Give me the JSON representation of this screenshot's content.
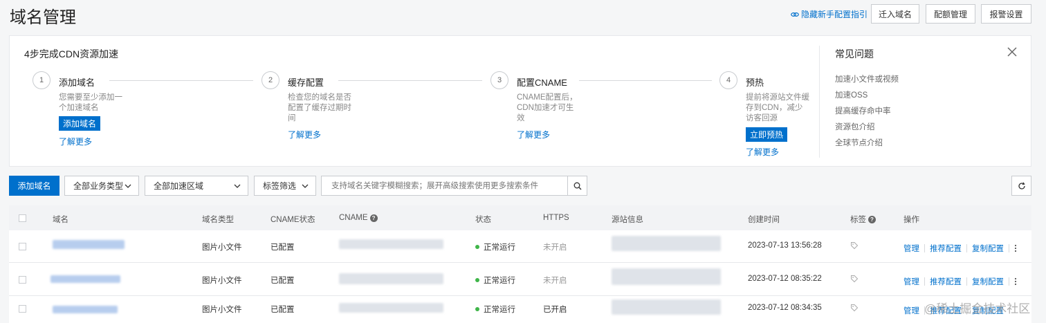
{
  "page": {
    "title": "域名管理"
  },
  "header": {
    "guide_link": "隐藏新手配置指引",
    "buttons": [
      "迁入域名",
      "配额管理",
      "报警设置"
    ]
  },
  "guide": {
    "title": "4步完成CDN资源加速",
    "steps": [
      {
        "num": "1",
        "title": "添加域名",
        "desc": [
          "您需要至少添加一",
          "个加速域名"
        ],
        "button": "添加域名",
        "link": "了解更多"
      },
      {
        "num": "2",
        "title": "缓存配置",
        "desc": [
          "检查您的域名是否",
          "配置了缓存过期时",
          "间"
        ],
        "link": "了解更多"
      },
      {
        "num": "3",
        "title": "配置CNAME",
        "desc": [
          "CNAME配置后，",
          "CDN加速才可生",
          "效"
        ],
        "link": "了解更多"
      },
      {
        "num": "4",
        "title": "预热",
        "desc": [
          "提前将源站文件缓",
          "存到CDN，减少",
          "访客回源"
        ],
        "button": "立即预热",
        "link": "了解更多"
      }
    ],
    "faq_title": "常见问题",
    "faq": [
      "加速小文件或视频",
      "加速OSS",
      "提高缓存命中率",
      "资源包介绍",
      "全球节点介绍"
    ]
  },
  "toolbar": {
    "add_button": "添加域名",
    "business_type": "全部业务类型",
    "region": "全部加速区域",
    "tag_filter": "标签筛选",
    "search_placeholder": "支持域名关键字模糊搜索；展开高级搜索使用更多搜索条件"
  },
  "table": {
    "headers": {
      "domain": "域名",
      "type": "域名类型",
      "cname_status": "CNAME状态",
      "cname": "CNAME",
      "status": "状态",
      "https": "HTTPS",
      "origin": "源站信息",
      "created": "创建时间",
      "tags": "标签",
      "actions": "操作"
    },
    "rows": [
      {
        "type": "图片小文件",
        "cname_status": "已配置",
        "status": "正常运行",
        "https": "未开启",
        "created": "2023-07-13 13:56:28"
      },
      {
        "type": "图片小文件",
        "cname_status": "已配置",
        "status": "正常运行",
        "https": "未开启",
        "created": "2023-07-12 08:35:22"
      },
      {
        "type": "图片小文件",
        "cname_status": "已配置",
        "status": "正常运行",
        "https": "已开启",
        "created": "2023-07-12 08:34:35"
      }
    ],
    "row_actions": [
      "管理",
      "推荐配置",
      "复制配置"
    ]
  },
  "watermark": "@稀土掘金技术社区",
  "colors": {
    "primary": "#0070cc",
    "status_ok": "#3fb549"
  }
}
